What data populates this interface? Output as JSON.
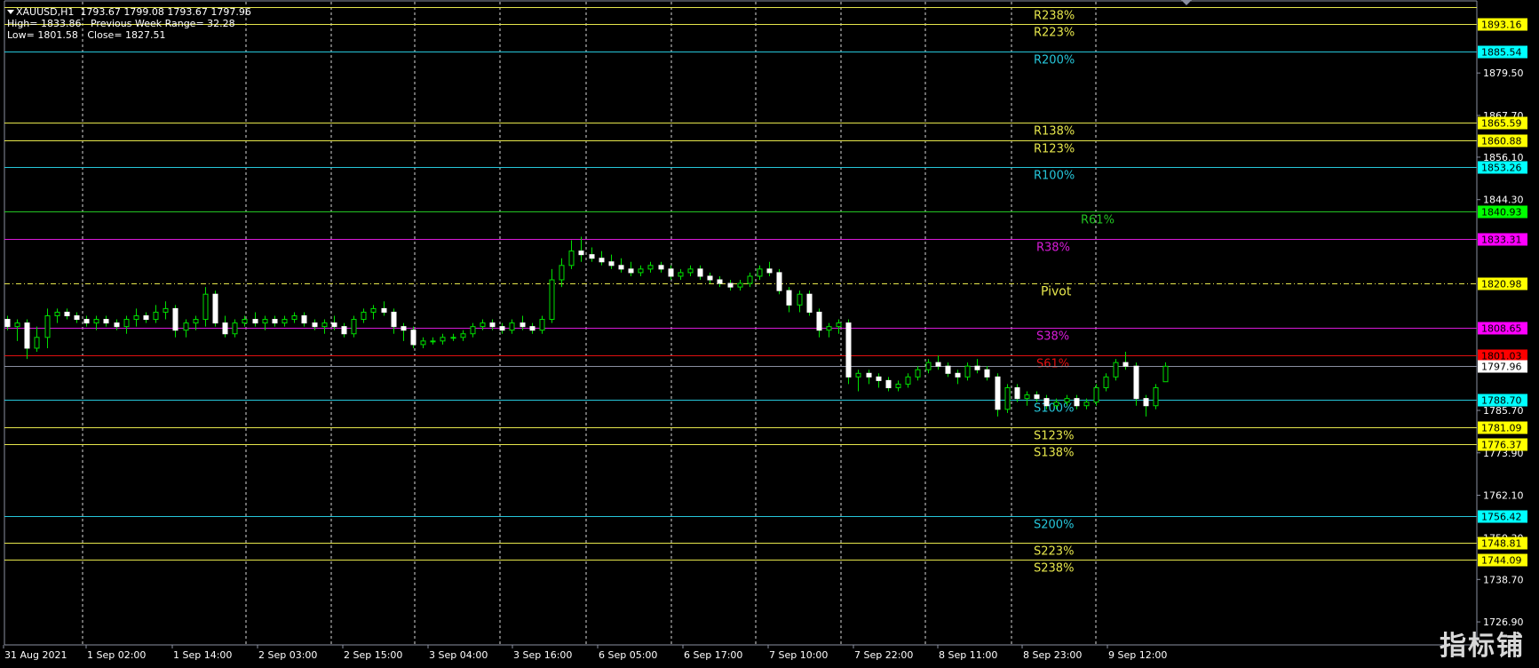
{
  "header": {
    "line1": "XAUUSD,H1  1793.67 1799.08 1793.67 1797.96",
    "line2": "High= 1833.86   Previous Week Range= 32.28",
    "line3": "Low= 1801.58   Close= 1827.51"
  },
  "price_scale": {
    "ticks": [
      "1879.50",
      "1867.70",
      "1856.10",
      "1844.30",
      "1785.70",
      "1773.90",
      "1762.10",
      "1750.30",
      "1738.70",
      "1726.90"
    ]
  },
  "time_axis": {
    "labels": [
      "31 Aug 2021",
      "1 Sep 02:00",
      "1 Sep 14:00",
      "2 Sep 03:00",
      "2 Sep 15:00",
      "3 Sep 04:00",
      "3 Sep 16:00",
      "6 Sep 05:00",
      "6 Sep 17:00",
      "7 Sep 10:00",
      "7 Sep 22:00",
      "8 Sep 11:00",
      "8 Sep 23:00",
      "9 Sep 12:00"
    ]
  },
  "levels": [
    {
      "label": "R238%",
      "price": "1897.89",
      "color": "#e6e64c",
      "tag": "",
      "tag_bg": "#e6e64c",
      "tag_fg": "#000"
    },
    {
      "label": "R223%",
      "price": "1893.16",
      "color": "#e6e64c",
      "tag": "1893.16",
      "tag_bg": "#ffff00",
      "tag_fg": "#000"
    },
    {
      "label": "R200%",
      "price": "1885.54",
      "color": "#26c6da",
      "tag": "1885.54",
      "tag_bg": "#00ffff",
      "tag_fg": "#000"
    },
    {
      "label": "R138%",
      "price": "1865.59",
      "color": "#e6e64c",
      "tag": "1865.59",
      "tag_bg": "#ffff00",
      "tag_fg": "#000"
    },
    {
      "label": "R123%",
      "price": "1860.88",
      "color": "#e6e64c",
      "tag": "1860.88",
      "tag_bg": "#ffff00",
      "tag_fg": "#000"
    },
    {
      "label": "R100%",
      "price": "1853.26",
      "color": "#26c6da",
      "tag": "1853.26",
      "tag_bg": "#00ffff",
      "tag_fg": "#000"
    },
    {
      "label": "R61%",
      "price": "1840.93",
      "color": "#22c322",
      "tag": "1840.93",
      "tag_bg": "#00ff00",
      "tag_fg": "#000"
    },
    {
      "label": "R38%",
      "price": "1833.31",
      "color": "#d81bd8",
      "tag": "1833.31",
      "tag_bg": "#ff00ff",
      "tag_fg": "#000"
    },
    {
      "label": "Pivot",
      "price": "1820.98",
      "color": "#e6e64c",
      "tag": "1820.98",
      "tag_bg": "#ffff00",
      "tag_fg": "#000",
      "dashed": true
    },
    {
      "label": "S38%",
      "price": "1808.65",
      "color": "#d81bd8",
      "tag": "1808.65",
      "tag_bg": "#ff00ff",
      "tag_fg": "#000"
    },
    {
      "label": "S61%",
      "price": "1801.03",
      "color": "#e01010",
      "tag": "1801.03",
      "tag_bg": "#ff0000",
      "tag_fg": "#000"
    },
    {
      "label": "",
      "price": "1797.96",
      "color": "#8a8fa0",
      "tag": "1797.96",
      "tag_bg": "#ffffff",
      "tag_fg": "#000"
    },
    {
      "label": "S100%",
      "price": "1788.70",
      "color": "#26c6da",
      "tag": "1788.70",
      "tag_bg": "#00ffff",
      "tag_fg": "#000"
    },
    {
      "label": "S123%",
      "price": "1781.09",
      "color": "#e6e64c",
      "tag": "1781.09",
      "tag_bg": "#ffff00",
      "tag_fg": "#000"
    },
    {
      "label": "S138%",
      "price": "1776.37",
      "color": "#e6e64c",
      "tag": "1776.37",
      "tag_bg": "#ffff00",
      "tag_fg": "#000"
    },
    {
      "label": "S200%",
      "price": "1756.42",
      "color": "#26c6da",
      "tag": "1756.42",
      "tag_bg": "#00ffff",
      "tag_fg": "#000"
    },
    {
      "label": "S223%",
      "price": "1748.81",
      "color": "#e6e64c",
      "tag": "1748.81",
      "tag_bg": "#ffff00",
      "tag_fg": "#000"
    },
    {
      "label": "S238%",
      "price": "1744.09",
      "color": "#e6e64c",
      "tag": "1744.09",
      "tag_bg": "#ffff00",
      "tag_fg": "#000"
    }
  ],
  "chart_data": {
    "type": "candlestick",
    "symbol": "XAUUSD",
    "timeframe": "H1",
    "ylim": [
      1720.5,
      1899.3
    ],
    "candles": [
      [
        1811,
        1812,
        1808,
        1809
      ],
      [
        1809,
        1811,
        1805,
        1810
      ],
      [
        1810,
        1811,
        1800,
        1803
      ],
      [
        1803,
        1809,
        1802,
        1806
      ],
      [
        1806,
        1814,
        1803,
        1812
      ],
      [
        1812,
        1814,
        1810,
        1813
      ],
      [
        1813,
        1814,
        1811,
        1812
      ],
      [
        1812,
        1813,
        1810,
        1811
      ],
      [
        1811,
        1812,
        1809,
        1810
      ],
      [
        1810,
        1812,
        1808,
        1811
      ],
      [
        1811,
        1812,
        1809,
        1810
      ],
      [
        1810,
        1811,
        1808,
        1809
      ],
      [
        1809,
        1812,
        1807,
        1811
      ],
      [
        1811,
        1814,
        1809,
        1812
      ],
      [
        1812,
        1813,
        1810,
        1811
      ],
      [
        1811,
        1815,
        1810,
        1813
      ],
      [
        1813,
        1816,
        1811,
        1814
      ],
      [
        1814,
        1815,
        1806,
        1808
      ],
      [
        1808,
        1811,
        1806,
        1810
      ],
      [
        1810,
        1812,
        1808,
        1811
      ],
      [
        1811,
        1820,
        1809,
        1818
      ],
      [
        1818,
        1819,
        1809,
        1810
      ],
      [
        1810,
        1812,
        1806,
        1807
      ],
      [
        1807,
        1811,
        1806,
        1810
      ],
      [
        1810,
        1812,
        1809,
        1811
      ],
      [
        1811,
        1813,
        1809,
        1810
      ],
      [
        1810,
        1812,
        1808,
        1811
      ],
      [
        1811,
        1812,
        1809,
        1810
      ],
      [
        1810,
        1812,
        1809,
        1811
      ],
      [
        1811,
        1813,
        1810,
        1812
      ],
      [
        1812,
        1813,
        1809,
        1810
      ],
      [
        1810,
        1811,
        1808,
        1809
      ],
      [
        1809,
        1811,
        1807,
        1810
      ],
      [
        1810,
        1812,
        1808,
        1809
      ],
      [
        1809,
        1810,
        1806,
        1807
      ],
      [
        1807,
        1812,
        1806,
        1811
      ],
      [
        1811,
        1814,
        1810,
        1813
      ],
      [
        1813,
        1815,
        1811,
        1814
      ],
      [
        1814,
        1816,
        1812,
        1813
      ],
      [
        1813,
        1814,
        1807,
        1809
      ],
      [
        1809,
        1810,
        1805,
        1808
      ],
      [
        1808,
        1809,
        1803,
        1804
      ],
      [
        1804,
        1806,
        1803,
        1805
      ],
      [
        1805,
        1806,
        1804,
        1805
      ],
      [
        1805,
        1807,
        1804,
        1806
      ],
      [
        1806,
        1807,
        1805,
        1806
      ],
      [
        1806,
        1808,
        1805,
        1807
      ],
      [
        1807,
        1810,
        1806,
        1809
      ],
      [
        1809,
        1811,
        1808,
        1810
      ],
      [
        1810,
        1811,
        1808,
        1809
      ],
      [
        1809,
        1810,
        1807,
        1808
      ],
      [
        1808,
        1811,
        1807,
        1810
      ],
      [
        1810,
        1812,
        1808,
        1809
      ],
      [
        1809,
        1810,
        1807,
        1808
      ],
      [
        1808,
        1812,
        1807,
        1811
      ],
      [
        1811,
        1825,
        1810,
        1822
      ],
      [
        1822,
        1828,
        1820,
        1826
      ],
      [
        1826,
        1833,
        1825,
        1830
      ],
      [
        1830,
        1834,
        1827,
        1829
      ],
      [
        1829,
        1831,
        1827,
        1828
      ],
      [
        1828,
        1830,
        1826,
        1827
      ],
      [
        1827,
        1829,
        1825,
        1826
      ],
      [
        1826,
        1828,
        1824,
        1825
      ],
      [
        1825,
        1827,
        1823,
        1824
      ],
      [
        1824,
        1826,
        1823,
        1825
      ],
      [
        1825,
        1827,
        1824,
        1826
      ],
      [
        1826,
        1827,
        1824,
        1825
      ],
      [
        1825,
        1826,
        1822,
        1823
      ],
      [
        1823,
        1825,
        1822,
        1824
      ],
      [
        1824,
        1826,
        1823,
        1825
      ],
      [
        1825,
        1826,
        1822,
        1823
      ],
      [
        1823,
        1824,
        1821,
        1822
      ],
      [
        1822,
        1823,
        1820,
        1821
      ],
      [
        1821,
        1822,
        1819,
        1820
      ],
      [
        1820,
        1822,
        1819,
        1821
      ],
      [
        1821,
        1824,
        1820,
        1823
      ],
      [
        1823,
        1826,
        1822,
        1825
      ],
      [
        1825,
        1827,
        1823,
        1824
      ],
      [
        1824,
        1825,
        1818,
        1819
      ],
      [
        1819,
        1820,
        1813,
        1815
      ],
      [
        1815,
        1819,
        1813,
        1818
      ],
      [
        1818,
        1819,
        1812,
        1813
      ],
      [
        1813,
        1814,
        1806,
        1808
      ],
      [
        1808,
        1810,
        1806,
        1809
      ],
      [
        1809,
        1811,
        1807,
        1810
      ],
      [
        1810,
        1811,
        1793,
        1795
      ],
      [
        1795,
        1797,
        1791,
        1796
      ],
      [
        1796,
        1797,
        1793,
        1795
      ],
      [
        1795,
        1796,
        1792,
        1794
      ],
      [
        1794,
        1795,
        1791,
        1792
      ],
      [
        1792,
        1794,
        1791,
        1793
      ],
      [
        1793,
        1796,
        1792,
        1795
      ],
      [
        1795,
        1798,
        1794,
        1797
      ],
      [
        1797,
        1800,
        1796,
        1799
      ],
      [
        1799,
        1801,
        1797,
        1798
      ],
      [
        1798,
        1799,
        1795,
        1796
      ],
      [
        1796,
        1797,
        1793,
        1795
      ],
      [
        1795,
        1799,
        1794,
        1798
      ],
      [
        1798,
        1800,
        1796,
        1797
      ],
      [
        1797,
        1798,
        1794,
        1795
      ],
      [
        1795,
        1796,
        1784,
        1786
      ],
      [
        1786,
        1793,
        1785,
        1792
      ],
      [
        1792,
        1793,
        1788,
        1789
      ],
      [
        1789,
        1791,
        1787,
        1790
      ],
      [
        1790,
        1791,
        1788,
        1789
      ],
      [
        1789,
        1790,
        1786,
        1787
      ],
      [
        1787,
        1789,
        1786,
        1788
      ],
      [
        1788,
        1790,
        1787,
        1789
      ],
      [
        1789,
        1790,
        1786,
        1787
      ],
      [
        1787,
        1789,
        1786,
        1788
      ],
      [
        1788,
        1793,
        1787,
        1792
      ],
      [
        1792,
        1796,
        1791,
        1795
      ],
      [
        1795,
        1800,
        1794,
        1799
      ],
      [
        1799,
        1802,
        1797,
        1798
      ],
      [
        1798,
        1799,
        1787,
        1789
      ],
      [
        1789,
        1790,
        1784,
        1787
      ],
      [
        1787,
        1793,
        1786,
        1792
      ],
      [
        1793.67,
        1799.08,
        1793.67,
        1797.96
      ]
    ]
  }
}
